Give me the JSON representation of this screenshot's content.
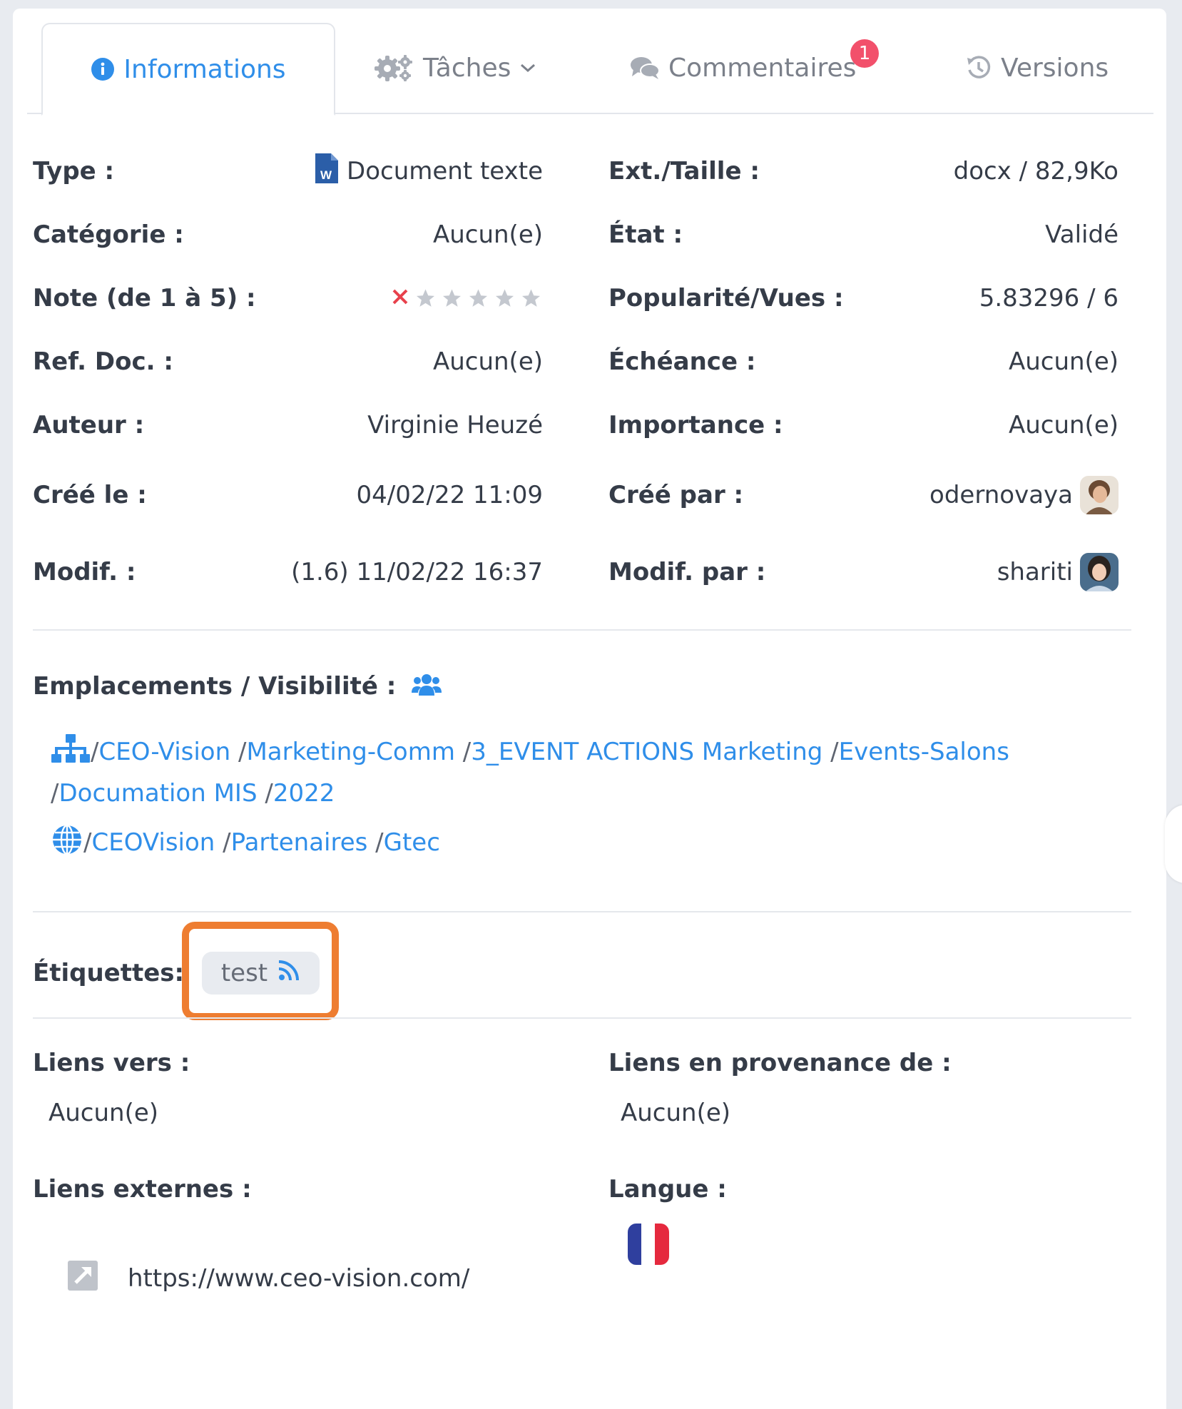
{
  "tabs": {
    "informations": "Informations",
    "taches": "Tâches",
    "commentaires": "Commentaires",
    "commentaires_badge": "1",
    "versions": "Versions"
  },
  "info": {
    "type_label": "Type :",
    "type_value": "Document texte",
    "ext_label": "Ext./Taille :",
    "ext_value": "docx / 82,9Ko",
    "categorie_label": "Catégorie :",
    "categorie_value": "Aucun(e)",
    "etat_label": "État :",
    "etat_value": "Validé",
    "note_label": "Note (de 1 à 5) :",
    "note_value": 0,
    "note_max": 5,
    "popularite_label": "Popularité/Vues :",
    "popularite_value": "5.83296 / 6",
    "ref_label": "Ref. Doc. :",
    "ref_value": "Aucun(e)",
    "echeance_label": "Échéance :",
    "echeance_value": "Aucun(e)",
    "auteur_label": "Auteur :",
    "auteur_value": "Virginie Heuzé",
    "importance_label": "Importance :",
    "importance_value": "Aucun(e)",
    "cree_le_label": "Créé le :",
    "cree_le_value": "04/02/22 11:09",
    "cree_par_label": "Créé par :",
    "cree_par_value": "odernovaya",
    "modif_label": "Modif. :",
    "modif_value": "(1.6) 11/02/22 16:37",
    "modif_par_label": "Modif. par :",
    "modif_par_value": "shariti"
  },
  "emplacements": {
    "label": "Emplacements / Visibilité :",
    "path1": [
      "CEO-Vision",
      "Marketing-Comm",
      "3_EVENT ACTIONS Marketing",
      "Events-Salons"
    ],
    "path1_cont": [
      "Documation MIS",
      "2022"
    ],
    "path2": [
      "CEOVision",
      "Partenaires",
      "Gtec"
    ]
  },
  "etiquettes": {
    "label": "Étiquettes:",
    "tag": "test"
  },
  "liens": {
    "vers_label": "Liens vers :",
    "vers_value": "Aucun(e)",
    "provenance_label": "Liens en provenance de :",
    "provenance_value": "Aucun(e)",
    "externes_label": "Liens externes :",
    "externes_value": "https://www.ceo-vision.com/",
    "langue_label": "Langue :"
  },
  "colors": {
    "accent": "#2f8ee9",
    "highlight": "#ee7d31",
    "badge": "#f2506b",
    "star_empty": "#c4c8cf",
    "clear_x": "#e8414c"
  },
  "icons": [
    "info-icon",
    "gears-icon",
    "chevron-down-icon",
    "comments-icon",
    "history-icon",
    "word-doc-icon",
    "star-icon",
    "users-icon",
    "sitemap-icon",
    "globe-icon",
    "rss-icon",
    "external-link-icon",
    "flag-fr-icon"
  ]
}
